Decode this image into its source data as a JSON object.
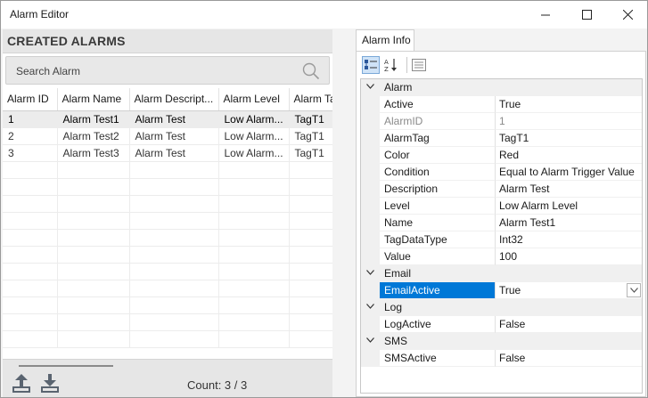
{
  "window": {
    "title": "Alarm Editor"
  },
  "left": {
    "header": "CREATED ALARMS",
    "search_placeholder": "Search Alarm",
    "columns": [
      "Alarm ID",
      "Alarm Name",
      "Alarm Descript...",
      "Alarm Level",
      "Alarm Ta"
    ],
    "rows": [
      [
        "1",
        "Alarm Test1",
        "Alarm Test",
        "Low Alarm...",
        "TagT1"
      ],
      [
        "2",
        "Alarm Test2",
        "Alarm Test",
        "Low Alarm...",
        "TagT1"
      ],
      [
        "3",
        "Alarm Test3",
        "Alarm Test",
        "Low Alarm...",
        "TagT1"
      ]
    ],
    "count": "Count: 3 / 3"
  },
  "right": {
    "tab": "Alarm Info",
    "categories": [
      {
        "name": "Alarm",
        "props": [
          [
            "Active",
            "True"
          ],
          [
            "AlarmID",
            "1"
          ],
          [
            "AlarmTag",
            "TagT1"
          ],
          [
            "Color",
            "Red"
          ],
          [
            "Condition",
            "Equal to Alarm Trigger Value"
          ],
          [
            "Description",
            "Alarm Test"
          ],
          [
            "Level",
            "Low Alarm Level"
          ],
          [
            "Name",
            "Alarm Test1"
          ],
          [
            "TagDataType",
            "Int32"
          ],
          [
            "Value",
            "100"
          ]
        ]
      },
      {
        "name": "Email",
        "props": [
          [
            "EmailActive",
            "True"
          ]
        ]
      },
      {
        "name": "Log",
        "props": [
          [
            "LogActive",
            "False"
          ]
        ]
      },
      {
        "name": "SMS",
        "props": [
          [
            "SMSActive",
            "False"
          ]
        ]
      }
    ]
  },
  "colors": {
    "selection": "#0078d7",
    "accent_light": "#cfe3f7"
  }
}
